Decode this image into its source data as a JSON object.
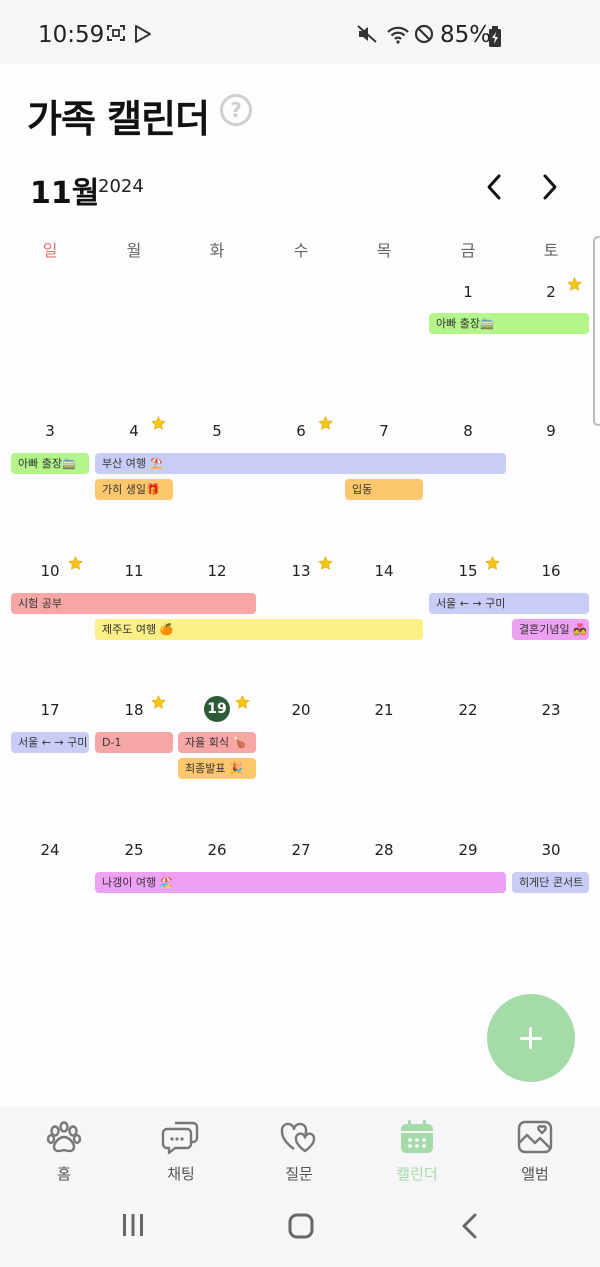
{
  "status_bar": {
    "time": "10:59",
    "battery": "85%",
    "icons": [
      "screenshot-icon",
      "play-store-icon",
      "mute-icon",
      "wifi-icon",
      "do-not-disturb-icon",
      "battery-charging-icon"
    ]
  },
  "header": {
    "title": "가족 캘린더",
    "help_icon": "help-circle-icon"
  },
  "calendar": {
    "month": "11월",
    "year": "2024",
    "weekdays": [
      "일",
      "월",
      "화",
      "수",
      "목",
      "금",
      "토"
    ],
    "today": "19",
    "weeks": [
      [
        "",
        "",
        "",
        "",
        "",
        "1",
        "2"
      ],
      [
        "3",
        "4",
        "5",
        "6",
        "7",
        "8",
        "9"
      ],
      [
        "10",
        "11",
        "12",
        "13",
        "14",
        "15",
        "16"
      ],
      [
        "17",
        "18",
        "19",
        "20",
        "21",
        "22",
        "23"
      ],
      [
        "24",
        "25",
        "26",
        "27",
        "28",
        "29",
        "30"
      ]
    ],
    "starred_days": [
      "2",
      "4",
      "6",
      "10",
      "13",
      "15",
      "18",
      "19"
    ],
    "events": [
      {
        "id": "e1",
        "label": "아빠 출장🚞",
        "color": "#b4f58a"
      },
      {
        "id": "e2",
        "label": "아빠 출장🚞",
        "color": "#b4f58a"
      },
      {
        "id": "e3",
        "label": "부산 여행 ⛱️",
        "color": "#c9cdf5"
      },
      {
        "id": "e4",
        "label": "가히 생일🎁",
        "color": "#fcc76d"
      },
      {
        "id": "e5",
        "label": "입동",
        "color": "#fcc76d"
      },
      {
        "id": "e6",
        "label": "시험 공부",
        "color": "#f7a6a6"
      },
      {
        "id": "e7",
        "label": "서울 ← → 구미",
        "color": "#c9cdf5"
      },
      {
        "id": "e8",
        "label": "제주도 여행 🍊",
        "color": "#fbef88"
      },
      {
        "id": "e9",
        "label": "결혼기념일 💑",
        "color": "#eea0f2"
      },
      {
        "id": "e10",
        "label": "서울 ← → 구미",
        "color": "#c9cdf5"
      },
      {
        "id": "e11",
        "label": "D-1",
        "color": "#f7a6a6"
      },
      {
        "id": "e12",
        "label": "자율 회식 🍗",
        "color": "#f7a6a6"
      },
      {
        "id": "e13",
        "label": "최종발표 🎉",
        "color": "#fcc76d"
      },
      {
        "id": "e14",
        "label": "나갱이 여행 🏖️",
        "color": "#eea0f2"
      },
      {
        "id": "e15",
        "label": "히게단 콘서트",
        "color": "#c9cdf5"
      }
    ]
  },
  "fab": {
    "icon": "plus-icon"
  },
  "bottom_nav": {
    "items": [
      {
        "label": "홈",
        "icon": "paw-icon"
      },
      {
        "label": "채팅",
        "icon": "chat-icon"
      },
      {
        "label": "질문",
        "icon": "hearts-icon"
      },
      {
        "label": "캘린더",
        "icon": "calendar-icon",
        "active": true
      },
      {
        "label": "앨범",
        "icon": "album-icon"
      }
    ]
  },
  "system_nav": {
    "icons": [
      "recents-icon",
      "home-icon",
      "back-icon"
    ]
  },
  "colors": {
    "accent": "#a5dba8",
    "today": "#2d5a37",
    "sunday": "#e86f6f"
  }
}
